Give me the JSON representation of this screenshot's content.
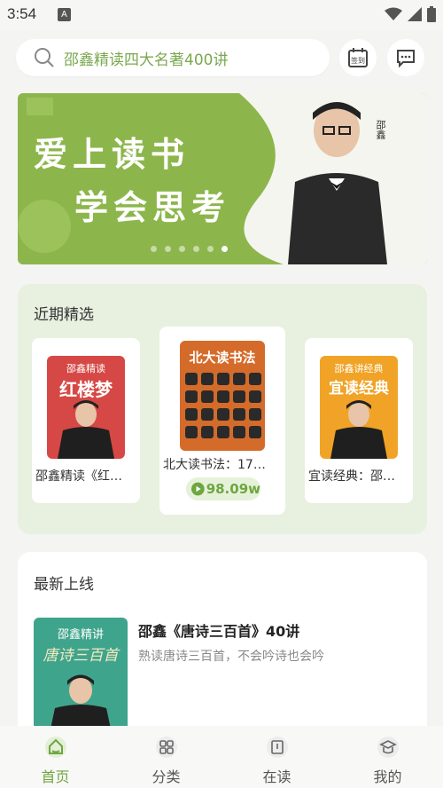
{
  "status_bar": {
    "time": "3:54",
    "app_icon": "A",
    "icons": [
      "wifi-icon",
      "signal-icon",
      "battery-icon"
    ]
  },
  "search": {
    "text": "邵鑫精读四大名著400讲",
    "icon": "search-icon"
  },
  "header_buttons": {
    "signin_label": "签到",
    "message_icon": "message-icon"
  },
  "banner": {
    "line1": "爱上读书",
    "line2": "学会思考",
    "author_name": "邵鑫",
    "dots": 6,
    "active_dot": 5
  },
  "recent": {
    "title": "近期精选",
    "books": [
      {
        "cover_title": "红楼梦",
        "cover_sub": "邵鑫精读",
        "name": "邵鑫精读《红…",
        "cover_color": "#d64845"
      },
      {
        "cover_title": "北大读书法",
        "cover_sub": "",
        "name": "北大读书法：17…",
        "cover_color": "#d56b2b",
        "play_count": "98.09w"
      },
      {
        "cover_title": "宜读经典",
        "cover_sub": "邵鑫讲经典",
        "name": "宜读经典：邵…",
        "cover_color": "#f0a326"
      }
    ]
  },
  "new_release": {
    "title": "最新上线",
    "cover_sub": "邵鑫精讲",
    "cover_title": "唐诗三百首",
    "item_title": "邵鑫《唐诗三百首》40讲",
    "item_desc": "熟读唐诗三百首，不会吟诗也会吟"
  },
  "tabs": [
    {
      "label": "首页",
      "icon": "home-icon",
      "active": true
    },
    {
      "label": "分类",
      "icon": "grid-icon",
      "active": false
    },
    {
      "label": "在读",
      "icon": "book-icon",
      "active": false
    },
    {
      "label": "我的",
      "icon": "profile-icon",
      "active": false
    }
  ],
  "colors": {
    "accent": "#6ea640",
    "banner_green": "#8cb64b"
  }
}
